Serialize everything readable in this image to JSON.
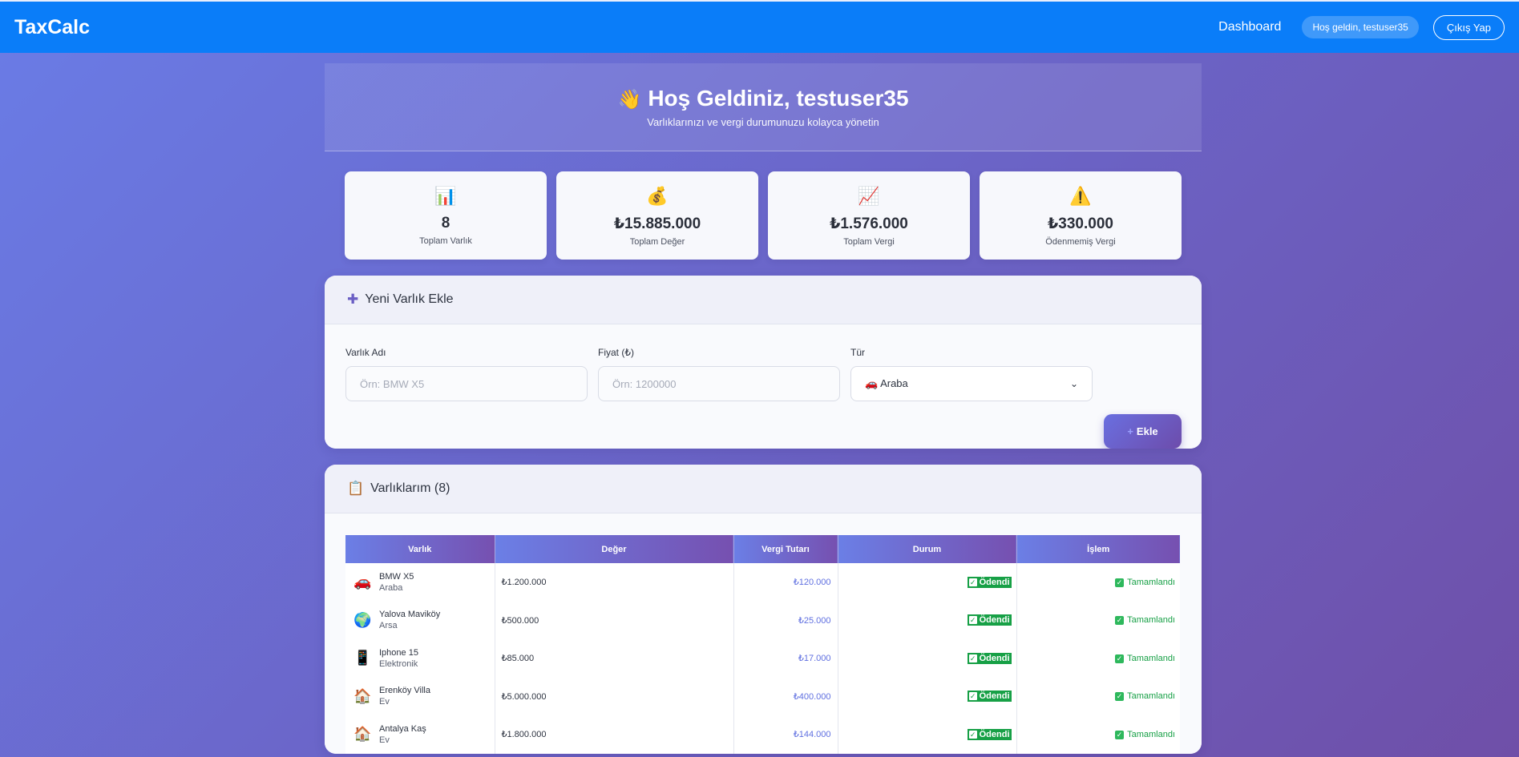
{
  "nav": {
    "brand": "TaxCalc",
    "dashboard": "Dashboard",
    "welcome_badge": "Hoş geldin, testuser35",
    "logout": "Çıkış Yap"
  },
  "hero": {
    "icon": "👋",
    "title": "Hoş Geldiniz, testuser35",
    "subtitle": "Varlıklarınızı ve vergi durumunuzu kolayca yönetin"
  },
  "stats": [
    {
      "icon": "📊",
      "value": "8",
      "label": "Toplam Varlık"
    },
    {
      "icon": "💰",
      "value": "₺15.885.000",
      "label": "Toplam Değer"
    },
    {
      "icon": "📈",
      "value": "₺1.576.000",
      "label": "Toplam Vergi"
    },
    {
      "icon": "⚠️",
      "value": "₺330.000",
      "label": "Ödenmemiş Vergi"
    }
  ],
  "add_form": {
    "title": "Yeni Varlık Ekle",
    "name_label": "Varlık Adı",
    "name_placeholder": "Örn: BMW X5",
    "price_label": "Fiyat (₺)",
    "price_placeholder": "Örn: 1200000",
    "type_label": "Tür",
    "type_selected": "🚗 Araba",
    "submit": "Ekle"
  },
  "assets": {
    "title": "Varlıklarım (8)",
    "columns": [
      "Varlık",
      "Değer",
      "Vergi Tutarı",
      "Durum",
      "İşlem"
    ],
    "rows": [
      {
        "icon": "🚗",
        "name": "BMW X5",
        "type": "Araba",
        "value": "₺1.200.000",
        "tax": "₺120.000",
        "status": "Ödendi",
        "action": "Tamamlandı"
      },
      {
        "icon": "🌍",
        "name": "Yalova Maviköy",
        "type": "Arsa",
        "value": "₺500.000",
        "tax": "₺25.000",
        "status": "Ödendi",
        "action": "Tamamlandı"
      },
      {
        "icon": "📱",
        "name": "Iphone 15",
        "type": "Elektronik",
        "value": "₺85.000",
        "tax": "₺17.000",
        "status": "Ödendi",
        "action": "Tamamlandı"
      },
      {
        "icon": "🏠",
        "name": "Erenköy Villa",
        "type": "Ev",
        "value": "₺5.000.000",
        "tax": "₺400.000",
        "status": "Ödendi",
        "action": "Tamamlandı"
      },
      {
        "icon": "🏠",
        "name": "Antalya Kaş",
        "type": "Ev",
        "value": "₺1.800.000",
        "tax": "₺144.000",
        "status": "Ödendi",
        "action": "Tamamlandı"
      }
    ]
  }
}
